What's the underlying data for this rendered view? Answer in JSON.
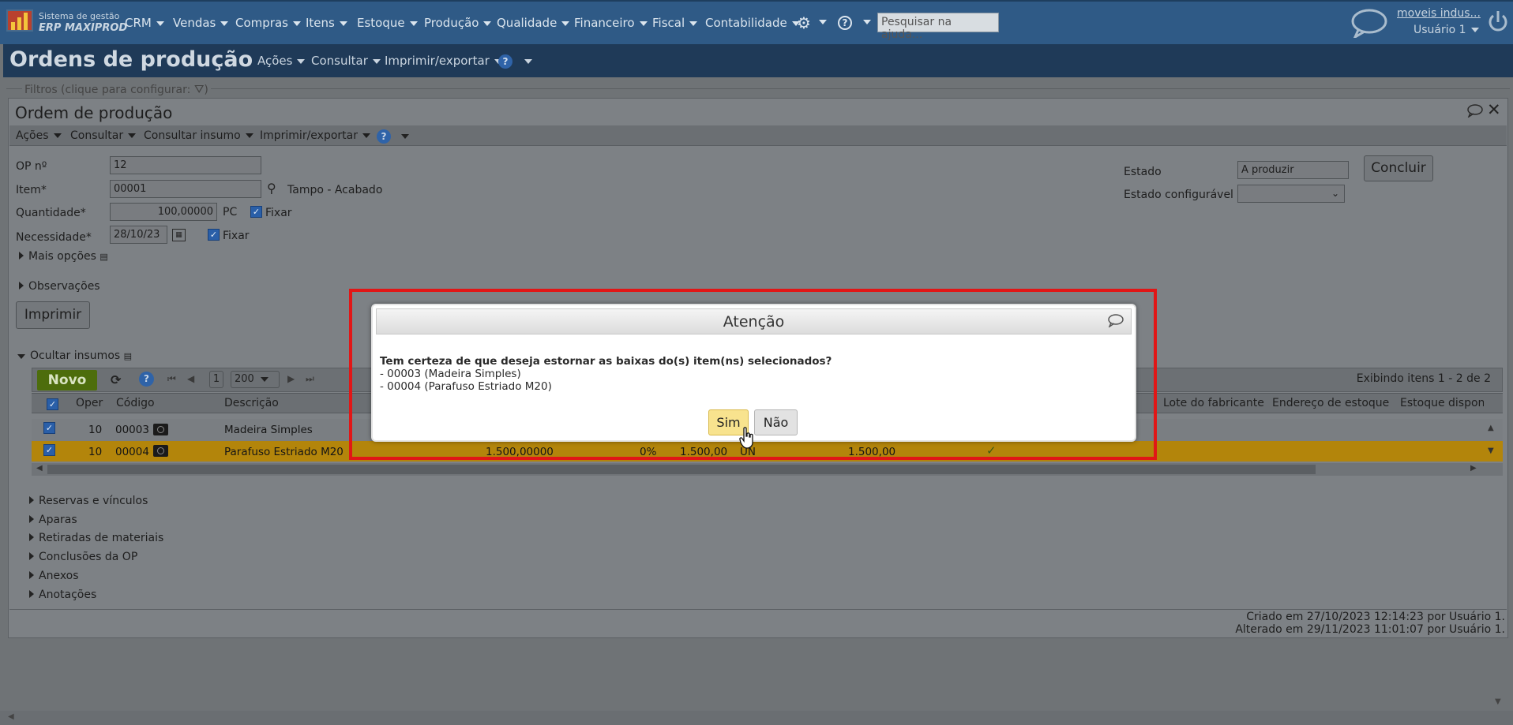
{
  "app": {
    "logo_line1": "Sistema de gestão",
    "logo_line2": "ERP MAXIPROD",
    "menu": [
      "CRM",
      "Vendas",
      "Compras",
      "Itens",
      "Estoque",
      "Produção",
      "Qualidade",
      "Financeiro",
      "Fiscal",
      "Contabilidade"
    ],
    "search_placeholder": "Pesquisar na ajuda...",
    "company": "moveis indus...",
    "user": "Usuário 1"
  },
  "page": {
    "title": "Ordens de produção",
    "menu": [
      "Ações",
      "Consultar",
      "Imprimir/exportar"
    ],
    "filters": "Filtros (clique para configurar:",
    "filters_end": ")"
  },
  "panel": {
    "title": "Ordem de produção",
    "toolbar": [
      "Ações",
      "Consultar",
      "Consultar insumo",
      "Imprimir/exportar"
    ],
    "form": {
      "op_label": "OP nº",
      "op_value": "12",
      "item_label": "Item*",
      "item_value": "00001",
      "item_desc": "Tampo - Acabado",
      "qty_label": "Quantidade*",
      "qty_value": "100,00000",
      "qty_unit": "PC",
      "fixar": "Fixar",
      "need_label": "Necessidade*",
      "need_value": "28/10/23",
      "fixar2": "Fixar",
      "more_options": "Mais opções",
      "state_label": "Estado",
      "state_value": "A produzir",
      "config_state_label": "Estado configurável",
      "config_state_value": "",
      "conclude_button": "Concluir",
      "observations": "Observações",
      "print_button": "Imprimir",
      "hide_inputs": "Ocultar insumos"
    },
    "grid": {
      "new_button": "Novo",
      "page": "1",
      "page_size": "200",
      "showing": "Exibindo itens 1 - 2 de 2",
      "headers": [
        "Oper",
        "Código",
        "Descrição",
        "Lote do fabricante",
        "Endereço de estoque",
        "Estoque disponí"
      ],
      "rows": [
        {
          "oper": "10",
          "code": "00003",
          "desc": "Madeira Simples",
          "qty": "",
          "perc": "",
          "q2": "",
          "unit": "",
          "q3": ""
        },
        {
          "oper": "10",
          "code": "00004",
          "desc": "Parafuso Estriado M20",
          "qty": "1.500,00000",
          "perc": "0%",
          "q2": "1.500,00",
          "unit": "UN",
          "q3": "1.500,00"
        }
      ]
    },
    "sections": [
      "Reservas e vínculos",
      "Aparas",
      "Retiradas de materiais",
      "Conclusões da OP",
      "Anexos",
      "Anotações"
    ],
    "created": "Criado em 27/10/2023 12:14:23 por Usuário 1.",
    "altered": "Alterado em 29/11/2023 11:01:07 por Usuário 1."
  },
  "dialog": {
    "title": "Atenção",
    "question": "Tem certeza de que deseja estornar as baixas do(s) item(ns) selecionados?",
    "lines": [
      "- 00003 (Madeira Simples)",
      "- 00004 (Parafuso Estriado M20)"
    ],
    "yes": "Sim",
    "no": "Não"
  },
  "colors": {
    "highlight_row": "#b3850b",
    "annotation_box": "#e11616",
    "yes_button": "#f8e38e"
  }
}
